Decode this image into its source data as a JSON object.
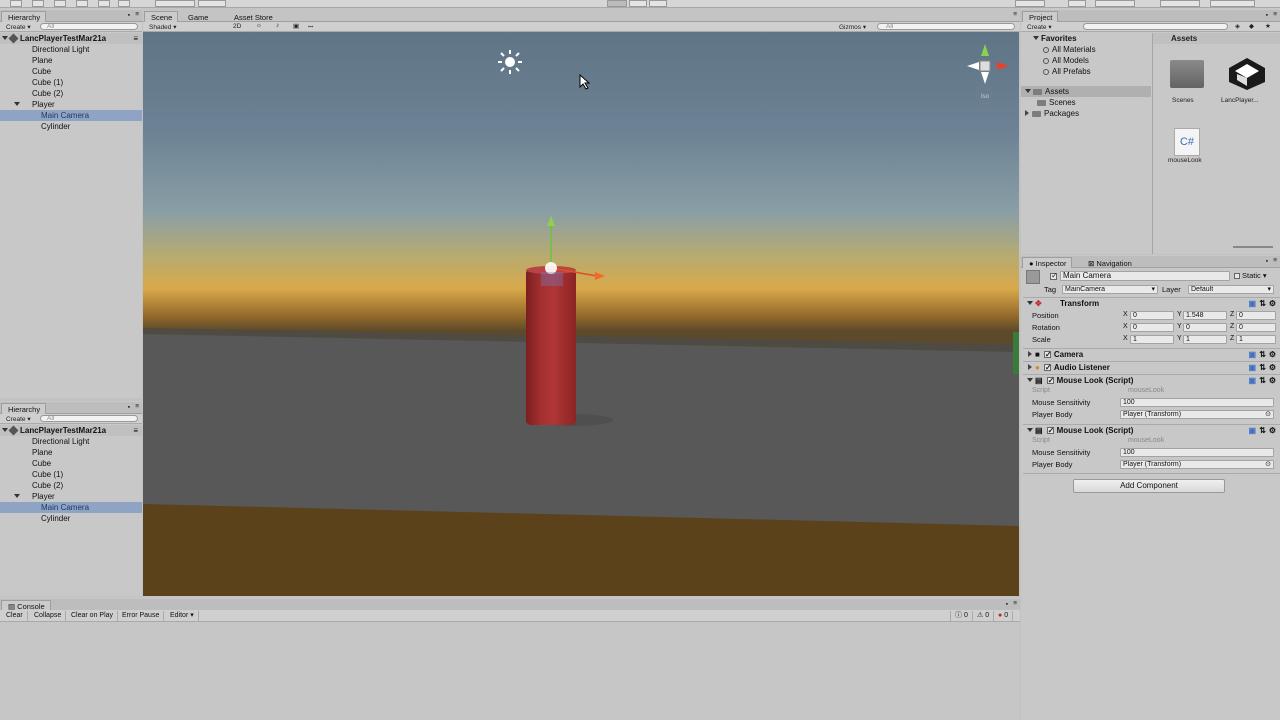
{
  "hierarchy": {
    "tab_label": "Hierarchy",
    "create_label": "Create",
    "search_placeholder": "All",
    "scene_name": "LancPlayerTestMar21a",
    "items": [
      {
        "label": "Directional Light"
      },
      {
        "label": "Plane"
      },
      {
        "label": "Cube"
      },
      {
        "label": "Cube (1)"
      },
      {
        "label": "Cube (2)"
      },
      {
        "label": "Player"
      },
      {
        "label": "Main Camera"
      },
      {
        "label": "Cylinder"
      }
    ]
  },
  "hierarchy2": {
    "tab_label": "Hierarchy",
    "create_label": "Create",
    "search_placeholder": "All",
    "scene_name": "LancPlayerTestMar21a",
    "items": [
      {
        "label": "Directional Light"
      },
      {
        "label": "Plane"
      },
      {
        "label": "Cube"
      },
      {
        "label": "Cube (1)"
      },
      {
        "label": "Cube (2)"
      },
      {
        "label": "Player"
      },
      {
        "label": "Main Camera"
      },
      {
        "label": "Cylinder"
      }
    ]
  },
  "scene": {
    "tabs": [
      {
        "label": "Scene"
      },
      {
        "label": "Game"
      },
      {
        "label": "Asset Store"
      }
    ],
    "shading": "Shaded",
    "mode_2d": "2D",
    "gizmos": "Gizmos",
    "search_placeholder": "All",
    "gizmo_label": "Iso"
  },
  "project": {
    "tab_label": "Project",
    "create_label": "Create",
    "favorites_label": "Favorites",
    "favorites": [
      {
        "label": "All Materials"
      },
      {
        "label": "All Models"
      },
      {
        "label": "All Prefabs"
      }
    ],
    "assets_label": "Assets",
    "assets_children": [
      {
        "label": "Scenes"
      }
    ],
    "packages_label": "Packages",
    "breadcrumb": "Assets",
    "files": [
      {
        "label": "Scenes",
        "icon": "folder-icon"
      },
      {
        "label": "LancPlayer...",
        "icon": "unity-scene-icon"
      },
      {
        "label": "mouseLook",
        "icon": "csharp-script-icon"
      }
    ],
    "csharp_glyph": "C#"
  },
  "inspector": {
    "tabs": [
      {
        "label": "Inspector"
      },
      {
        "label": "Navigation"
      }
    ],
    "object_name": "Main Camera",
    "static_label": "Static",
    "tag_label": "Tag",
    "tag_value": "MainCamera",
    "layer_label": "Layer",
    "layer_value": "Default",
    "transform": {
      "title": "Transform",
      "rows": [
        {
          "label": "Position",
          "x": "0",
          "y": "1.548",
          "z": "0"
        },
        {
          "label": "Rotation",
          "x": "0",
          "y": "0",
          "z": "0"
        },
        {
          "label": "Scale",
          "x": "1",
          "y": "1",
          "z": "1"
        }
      ],
      "axis_x": "X",
      "axis_y": "Y",
      "axis_z": "Z"
    },
    "camera_title": "Camera",
    "audio_title": "Audio Listener",
    "scripts": [
      {
        "title": "Mouse Look (Script)",
        "script_label": "Script",
        "script_value": "mouseLook",
        "sensitivity_label": "Mouse Sensitivity",
        "sensitivity_value": "100",
        "body_label": "Player Body",
        "body_value": "Player (Transform)"
      },
      {
        "title": "Mouse Look (Script)",
        "script_label": "Script",
        "script_value": "mouseLook",
        "sensitivity_label": "Mouse Sensitivity",
        "sensitivity_value": "100",
        "body_label": "Player Body",
        "body_value": "Player (Transform)"
      }
    ],
    "add_component": "Add Component"
  },
  "console": {
    "tab_label": "Console",
    "buttons": [
      {
        "label": "Clear"
      },
      {
        "label": "Collapse"
      },
      {
        "label": "Clear on Play"
      },
      {
        "label": "Error Pause"
      },
      {
        "label": "Editor"
      }
    ],
    "log_count": "0",
    "warn_count": "0",
    "error_count": "0"
  },
  "colors": {
    "selection": "#8fa4c4",
    "cylinder": "#a33030",
    "sky_top": "#5f7586",
    "horizon": "#d8a94a",
    "ground": "#5a5a5a",
    "floor_near": "#5b421b"
  }
}
